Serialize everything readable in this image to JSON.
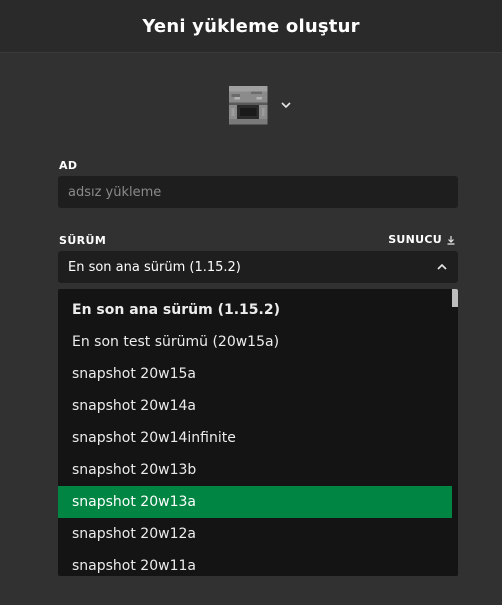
{
  "header": {
    "title": "Yeni yükleme oluştur"
  },
  "icon_picker": {
    "icon": "furnace-block-icon",
    "toggle_icon": "chevron-down-icon"
  },
  "name_field": {
    "label": "AD",
    "placeholder": "adsız yükleme",
    "value": ""
  },
  "version_field": {
    "label": "SÜRÜM",
    "server_link": "SUNUCU",
    "server_icon": "download-icon",
    "selected": "En son ana sürüm (1.15.2)",
    "toggle_icon": "chevron-up-icon"
  },
  "dropdown": {
    "options": [
      {
        "label": "En son ana sürüm (1.15.2)",
        "bold": true,
        "selected": false
      },
      {
        "label": "En son test sürümü (20w15a)",
        "bold": false,
        "selected": false
      },
      {
        "label": "snapshot 20w15a",
        "bold": false,
        "selected": false
      },
      {
        "label": "snapshot 20w14a",
        "bold": false,
        "selected": false
      },
      {
        "label": "snapshot 20w14infinite",
        "bold": false,
        "selected": false
      },
      {
        "label": "snapshot 20w13b",
        "bold": false,
        "selected": false
      },
      {
        "label": "snapshot 20w13a",
        "bold": false,
        "selected": true
      },
      {
        "label": "snapshot 20w12a",
        "bold": false,
        "selected": false
      },
      {
        "label": "snapshot 20w11a",
        "bold": false,
        "selected": false
      }
    ]
  },
  "colors": {
    "background": "#313131",
    "header": "#2a2a2a",
    "field": "#1e1e1e",
    "dropdown": "#141414",
    "selected_accent": "#008542"
  }
}
